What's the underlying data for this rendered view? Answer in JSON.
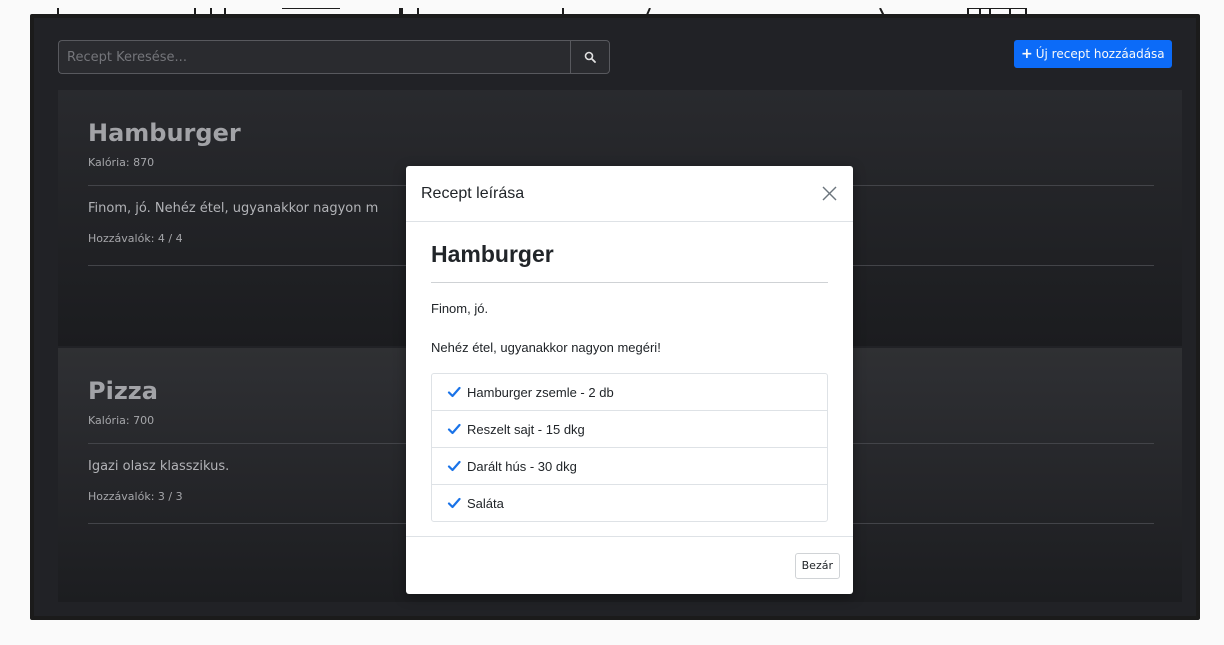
{
  "search": {
    "placeholder": "Recept Keresése...",
    "icon": "search-icon"
  },
  "toolbar": {
    "add_label": "Új recept hozzáadása",
    "add_icon": "plus-icon"
  },
  "recipes": [
    {
      "title": "Hamburger",
      "calories": "Kalória: 870",
      "description": "Finom, jó. Nehéz étel, ugyanakkor nagyon m",
      "ingredients": "Hozzávalók: 4 / 4"
    },
    {
      "title": "Pizza",
      "calories": "Kalória: 700",
      "description": "Igazi olasz klasszikus.",
      "ingredients": "Hozzávalók: 3 / 3"
    }
  ],
  "modal": {
    "title": "Recept leírása",
    "recipe_title": "Hamburger",
    "paragraphs": [
      "Finom, jó.",
      "Nehéz étel, ugyanakkor nagyon megéri!"
    ],
    "ingredients": [
      "Hamburger zsemle - 2 db",
      "Reszelt sajt - 15 dkg",
      "Darált hús - 30 dkg",
      "Saláta"
    ],
    "close_label": "Bezár"
  },
  "colors": {
    "accent": "#0d6efd",
    "check": "#1a73e8",
    "panel_bg": "#222327"
  }
}
